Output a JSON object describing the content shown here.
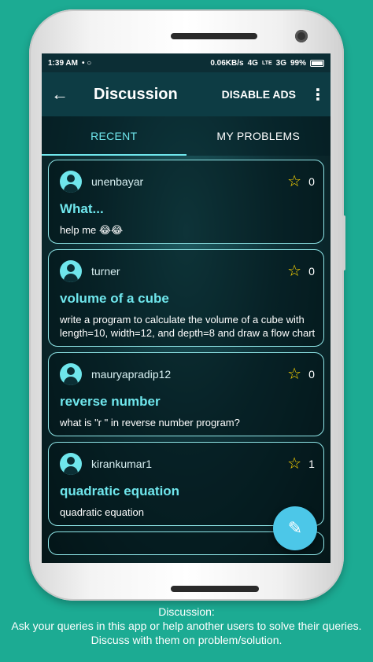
{
  "status": {
    "time": "1:39 AM",
    "left_icons": "• ○",
    "net_speed": "0.06KB/s",
    "network_1": "4G",
    "volte": "LTE",
    "network_2": "3G",
    "battery": "99%"
  },
  "appbar": {
    "back_icon": "←",
    "title": "Discussion",
    "disable_ads": "DISABLE ADS",
    "menu_icon": "⋮"
  },
  "tabs": [
    {
      "label": "RECENT"
    },
    {
      "label": "MY PROBLEMS"
    }
  ],
  "posts": [
    {
      "user": "unenbayar",
      "title": "What...",
      "body": "help me 😂😂",
      "stars": "0"
    },
    {
      "user": "turner",
      "title": "volume of a cube",
      "body": "write a program to calculate the volume of a cube with length=10, width=12, and depth=8 and draw a flow chart",
      "stars": "0"
    },
    {
      "user": "mauryapradip12",
      "title": "reverse number",
      "body": "what is \"r \" in reverse number program?",
      "stars": "0"
    },
    {
      "user": "kirankumar1",
      "title": "quadratic equation",
      "body": "quadratic equation",
      "stars": "1"
    }
  ],
  "star_icon": "☆",
  "fab_icon": "✎",
  "caption": {
    "line1": "Discussion:",
    "line2": "Ask your queries in this app or help another users to solve their queries.",
    "line3": "Discuss with them on problem/solution."
  },
  "colors": {
    "background": "#1cab93",
    "accent": "#6fe6ec",
    "star": "#ffd600",
    "fab": "#4cc7e8"
  }
}
